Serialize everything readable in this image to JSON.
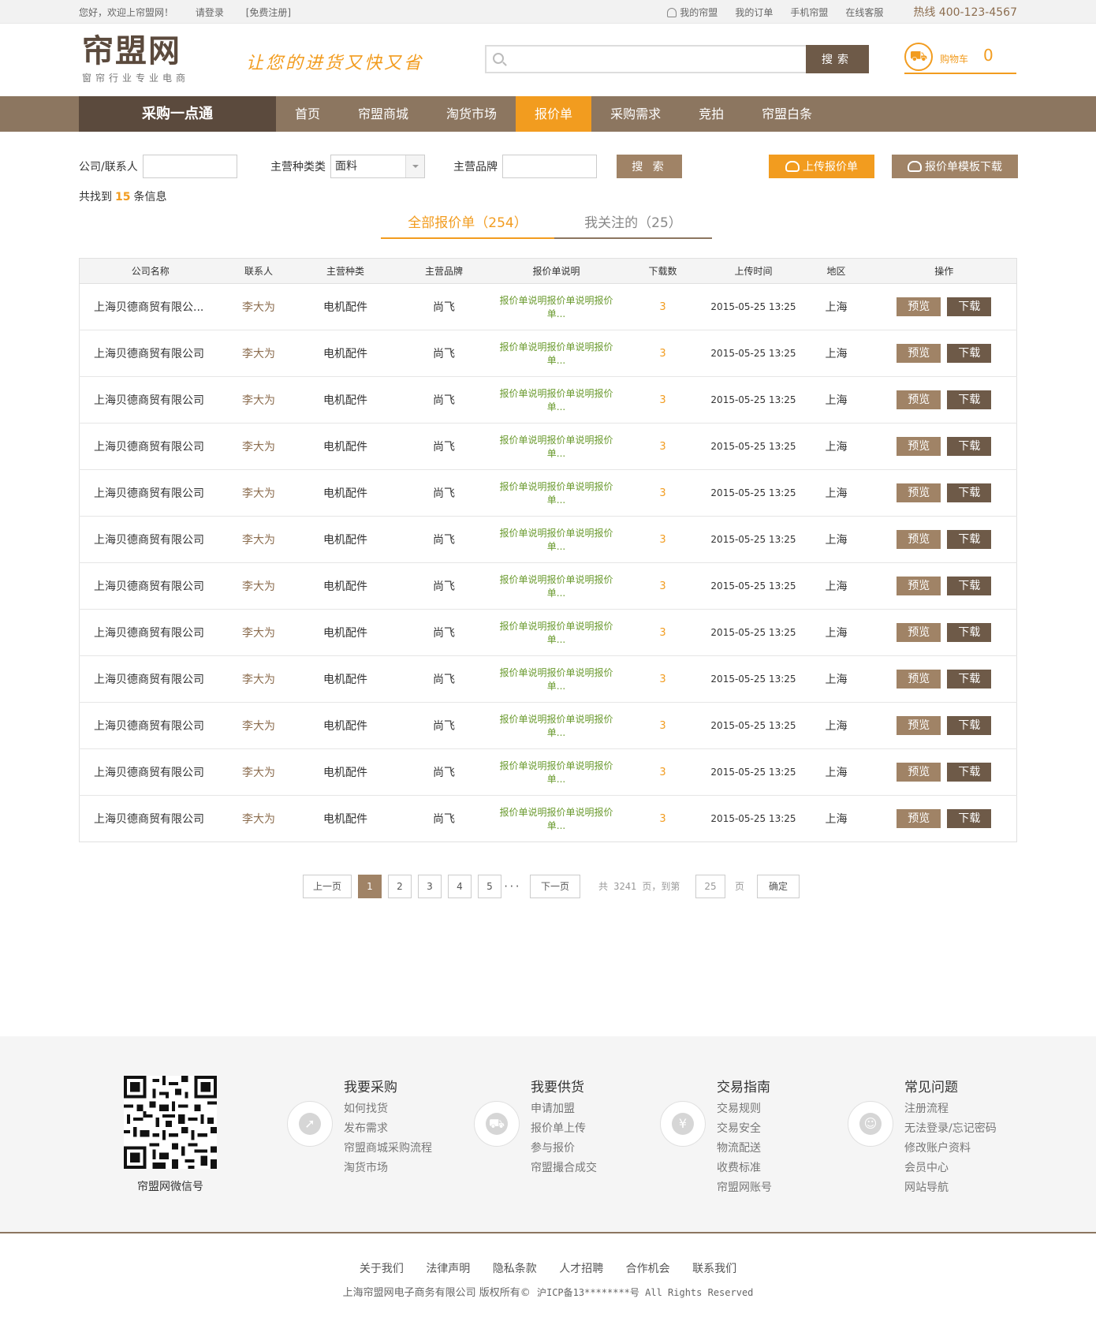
{
  "topbar": {
    "welcome": "您好，欢迎上帘盟网！",
    "login": "请登录",
    "register": "[免费注册]",
    "my_account": "我的帘盟",
    "my_orders": "我的订单",
    "mobile": "手机帘盟",
    "service": "在线客服",
    "hotline": "热线 400-123-4567"
  },
  "header": {
    "logo": "帘盟网",
    "logo_sub": "窗帘行业专业电商",
    "slogan": "让您的进货又快又省",
    "search_button": "搜索",
    "cart_label": "购物车",
    "cart_count": "0"
  },
  "nav": {
    "category": "采购一点通",
    "items": [
      "首页",
      "帘盟商城",
      "淘货市场",
      "报价单",
      "采购需求",
      "竞拍",
      "帘盟白条"
    ],
    "active": "报价单"
  },
  "filters": {
    "company_label": "公司/联系人",
    "category_label": "主营种类类",
    "category_value": "面料",
    "brand_label": "主营品牌",
    "search_button": "搜 索",
    "upload_button": "上传报价单",
    "template_button": "报价单模板下载"
  },
  "result": {
    "prefix": "共找到",
    "count": "15",
    "suffix": "条信息"
  },
  "tabs": {
    "all": "全部报价单（254）",
    "followed": "我关注的（25）"
  },
  "table": {
    "headers": [
      "公司名称",
      "联系人",
      "主营种类",
      "主营品牌",
      "报价单说明",
      "下载数",
      "上传时间",
      "地区",
      "操作"
    ],
    "preview_label": "预览",
    "download_label": "下载",
    "rows": [
      {
        "company": "上海贝德商贸有限公...",
        "contact": "李大为",
        "category": "电机配件",
        "brand": "尚飞",
        "desc": "报价单说明报价单说明报价单...",
        "downloads": "3",
        "time": "2015-05-25 13:25",
        "region": "上海"
      },
      {
        "company": "上海贝德商贸有限公司",
        "contact": "李大为",
        "category": "电机配件",
        "brand": "尚飞",
        "desc": "报价单说明报价单说明报价单...",
        "downloads": "3",
        "time": "2015-05-25 13:25",
        "region": "上海"
      },
      {
        "company": "上海贝德商贸有限公司",
        "contact": "李大为",
        "category": "电机配件",
        "brand": "尚飞",
        "desc": "报价单说明报价单说明报价单...",
        "downloads": "3",
        "time": "2015-05-25 13:25",
        "region": "上海"
      },
      {
        "company": "上海贝德商贸有限公司",
        "contact": "李大为",
        "category": "电机配件",
        "brand": "尚飞",
        "desc": "报价单说明报价单说明报价单...",
        "downloads": "3",
        "time": "2015-05-25 13:25",
        "region": "上海"
      },
      {
        "company": "上海贝德商贸有限公司",
        "contact": "李大为",
        "category": "电机配件",
        "brand": "尚飞",
        "desc": "报价单说明报价单说明报价单...",
        "downloads": "3",
        "time": "2015-05-25 13:25",
        "region": "上海"
      },
      {
        "company": "上海贝德商贸有限公司",
        "contact": "李大为",
        "category": "电机配件",
        "brand": "尚飞",
        "desc": "报价单说明报价单说明报价单...",
        "downloads": "3",
        "time": "2015-05-25 13:25",
        "region": "上海"
      },
      {
        "company": "上海贝德商贸有限公司",
        "contact": "李大为",
        "category": "电机配件",
        "brand": "尚飞",
        "desc": "报价单说明报价单说明报价单...",
        "downloads": "3",
        "time": "2015-05-25 13:25",
        "region": "上海"
      },
      {
        "company": "上海贝德商贸有限公司",
        "contact": "李大为",
        "category": "电机配件",
        "brand": "尚飞",
        "desc": "报价单说明报价单说明报价单...",
        "downloads": "3",
        "time": "2015-05-25 13:25",
        "region": "上海"
      },
      {
        "company": "上海贝德商贸有限公司",
        "contact": "李大为",
        "category": "电机配件",
        "brand": "尚飞",
        "desc": "报价单说明报价单说明报价单...",
        "downloads": "3",
        "time": "2015-05-25 13:25",
        "region": "上海"
      },
      {
        "company": "上海贝德商贸有限公司",
        "contact": "李大为",
        "category": "电机配件",
        "brand": "尚飞",
        "desc": "报价单说明报价单说明报价单...",
        "downloads": "3",
        "time": "2015-05-25 13:25",
        "region": "上海"
      },
      {
        "company": "上海贝德商贸有限公司",
        "contact": "李大为",
        "category": "电机配件",
        "brand": "尚飞",
        "desc": "报价单说明报价单说明报价单...",
        "downloads": "3",
        "time": "2015-05-25 13:25",
        "region": "上海"
      },
      {
        "company": "上海贝德商贸有限公司",
        "contact": "李大为",
        "category": "电机配件",
        "brand": "尚飞",
        "desc": "报价单说明报价单说明报价单...",
        "downloads": "3",
        "time": "2015-05-25 13:25",
        "region": "上海"
      }
    ]
  },
  "pager": {
    "prev": "上一页",
    "pages": [
      "1",
      "2",
      "3",
      "4",
      "5"
    ],
    "current": "1",
    "ellipsis": "···",
    "next": "下一页",
    "total_prefix": "共",
    "total_pages": "3241",
    "total_suffix": "页，到第",
    "goto_value": "25",
    "page_unit": "页",
    "confirm": "确定"
  },
  "footer": {
    "qr_caption": "帘盟网微信号",
    "columns": [
      {
        "title": "我要采购",
        "icon": "compass-icon",
        "links": [
          "如何找货",
          "发布需求",
          "帘盟商城采购流程",
          "淘货市场"
        ]
      },
      {
        "title": "我要供货",
        "icon": "truck-icon",
        "links": [
          "申请加盟",
          "报价单上传",
          "参与报价",
          "帘盟撮合成交"
        ]
      },
      {
        "title": "交易指南",
        "icon": "yen-icon",
        "links": [
          "交易规则",
          "交易安全",
          "物流配送",
          "收费标准",
          "帘盟网账号"
        ]
      },
      {
        "title": "常见问题",
        "icon": "user-icon",
        "links": [
          "注册流程",
          "无法登录/忘记密码",
          "修改账户资料",
          "会员中心",
          "网站导航"
        ]
      }
    ],
    "bottom_links": [
      "关于我们",
      "法律声明",
      "隐私条款",
      "人才招聘",
      "合作机会",
      "联系我们"
    ],
    "copyright": "上海帘盟网电子商务有限公司 版权所有©",
    "icp": "沪ICP备13********号 All Rights Reserved"
  }
}
